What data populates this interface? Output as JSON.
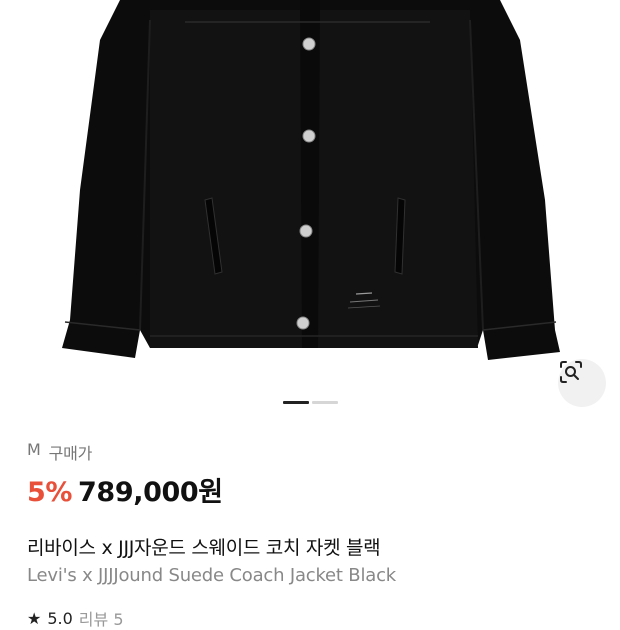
{
  "product": {
    "size_label": "M",
    "purchase_price_label": "구매가",
    "discount": "5%",
    "price": "789,000원",
    "title_korean": "리바이스 x JJJ자운드 스웨이드 코치 자켓 블랙",
    "title_english": "Levi's x JJJJound Suede Coach Jacket Black",
    "rating": "5.0",
    "review_label": "리뷰 5"
  },
  "gallery": {
    "total_images": 2,
    "active_index": 1
  },
  "colors": {
    "discount": "#e8503a",
    "jacket": "#0c0c0c"
  }
}
